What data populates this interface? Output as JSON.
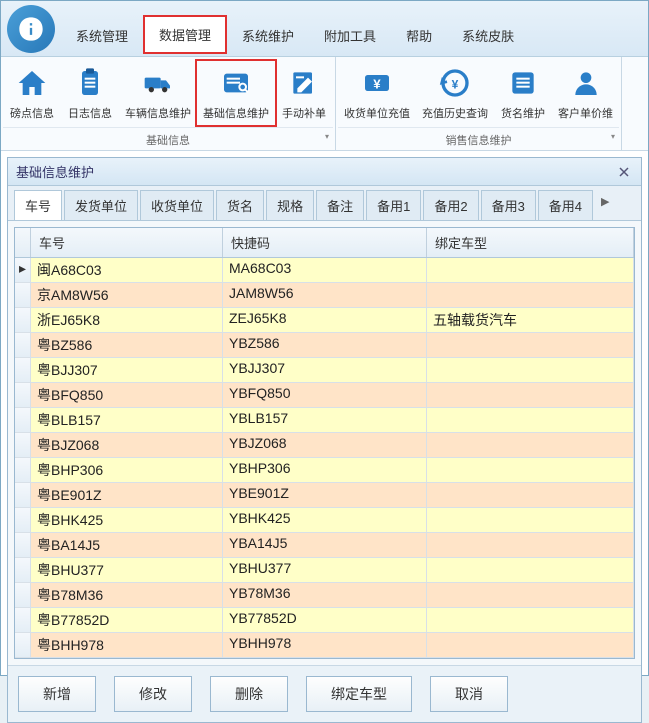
{
  "menu": [
    "系统管理",
    "数据管理",
    "系统维护",
    "附加工具",
    "帮助",
    "系统皮肤"
  ],
  "menu_active": 1,
  "ribbon_groups": [
    {
      "title": "基础信息",
      "items": [
        {
          "name": "pound-info",
          "label": "磅点信息",
          "icon": "home"
        },
        {
          "name": "log-info",
          "label": "日志信息",
          "icon": "clipboard"
        },
        {
          "name": "vehicle-maint",
          "label": "车辆信息维护",
          "icon": "truck"
        },
        {
          "name": "base-maint",
          "label": "基础信息维护",
          "icon": "card",
          "highlight": true
        },
        {
          "name": "manual-supp",
          "label": "手动补单",
          "icon": "edit"
        }
      ]
    },
    {
      "title": "销售信息维护",
      "items": [
        {
          "name": "recv-recharge",
          "label": "收货单位充值",
          "icon": "money"
        },
        {
          "name": "recharge-hist",
          "label": "充值历史查询",
          "icon": "history"
        },
        {
          "name": "goods-maint",
          "label": "货名维护",
          "icon": "list"
        },
        {
          "name": "cust-price",
          "label": "客户单价维",
          "icon": "user"
        }
      ]
    }
  ],
  "panel_title": "基础信息维护",
  "tabs": [
    "车号",
    "发货单位",
    "收货单位",
    "货名",
    "规格",
    "备注",
    "备用1",
    "备用2",
    "备用3",
    "备用4"
  ],
  "tab_active": 0,
  "columns": [
    "车号",
    "快捷码",
    "绑定车型"
  ],
  "rows": [
    {
      "c": "闽A68C03",
      "k": "MA68C03",
      "t": ""
    },
    {
      "c": "京AM8W56",
      "k": "JAM8W56",
      "t": ""
    },
    {
      "c": "浙EJ65K8",
      "k": "ZEJ65K8",
      "t": "五轴载货汽车"
    },
    {
      "c": "粤BZ586",
      "k": "YBZ586",
      "t": ""
    },
    {
      "c": "粤BJJ307",
      "k": "YBJJ307",
      "t": ""
    },
    {
      "c": "粤BFQ850",
      "k": "YBFQ850",
      "t": ""
    },
    {
      "c": "粤BLB157",
      "k": "YBLB157",
      "t": ""
    },
    {
      "c": "粤BJZ068",
      "k": "YBJZ068",
      "t": ""
    },
    {
      "c": "粤BHP306",
      "k": "YBHP306",
      "t": ""
    },
    {
      "c": "粤BE901Z",
      "k": "YBE901Z",
      "t": ""
    },
    {
      "c": "粤BHK425",
      "k": "YBHK425",
      "t": ""
    },
    {
      "c": "粤BA14J5",
      "k": "YBA14J5",
      "t": ""
    },
    {
      "c": "粤BHU377",
      "k": "YBHU377",
      "t": ""
    },
    {
      "c": "粤B78M36",
      "k": "YB78M36",
      "t": ""
    },
    {
      "c": "粤B77852D",
      "k": "YB77852D",
      "t": ""
    },
    {
      "c": "粤BHH978",
      "k": "YBHH978",
      "t": ""
    }
  ],
  "buttons": {
    "add": "新增",
    "edit": "修改",
    "del": "删除",
    "bind": "绑定车型",
    "cancel": "取消"
  }
}
